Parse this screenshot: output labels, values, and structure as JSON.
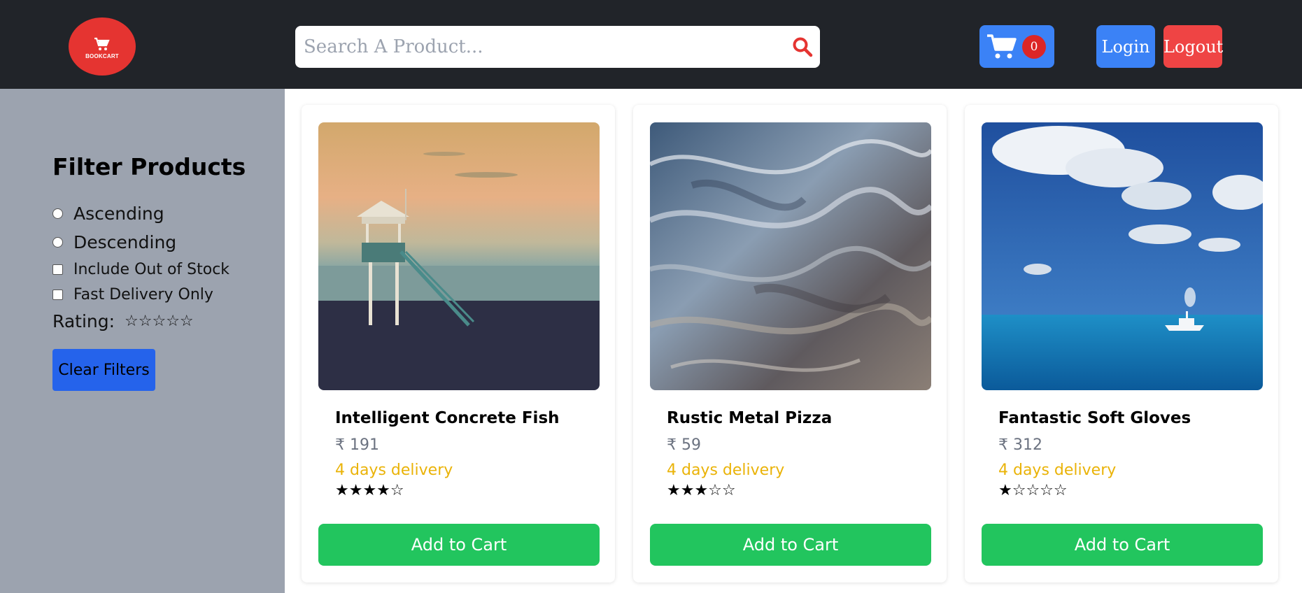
{
  "header": {
    "logo_text": "BOOKCART",
    "search_placeholder": "Search A Product...",
    "cart_count": "0",
    "login_label": "Login",
    "logout_label": "Logout",
    "colors": {
      "bg": "#212429",
      "logo": "#e53431",
      "cart": "#3b82f6",
      "login": "#3b82f6",
      "logout": "#ef4444"
    }
  },
  "sidebar": {
    "title": "Filter Products",
    "sort_options": [
      {
        "label": "Ascending",
        "checked": false
      },
      {
        "label": "Descending",
        "checked": false
      }
    ],
    "checkboxes": [
      {
        "label": "Include Out of Stock",
        "checked": false
      },
      {
        "label": "Fast Delivery Only",
        "checked": false
      }
    ],
    "rating_label": "Rating:",
    "rating_stars": "☆☆☆☆☆",
    "rating_value": 0,
    "clear_label": "Clear Filters"
  },
  "products": [
    {
      "name": "Intelligent Concrete Fish",
      "price": "₹ 191",
      "delivery": "4 days delivery",
      "rating": 4,
      "stars": "★★★★☆",
      "button": "Add to Cart",
      "image": "lifeguard-tower-beach"
    },
    {
      "name": "Rustic Metal Pizza",
      "price": "₹ 59",
      "delivery": "4 days delivery",
      "rating": 3,
      "stars": "★★★☆☆",
      "button": "Add to Cart",
      "image": "abstract-water-texture"
    },
    {
      "name": "Fantastic Soft Gloves",
      "price": "₹ 312",
      "delivery": "4 days delivery",
      "rating": 1,
      "stars": "★☆☆☆☆",
      "button": "Add to Cart",
      "image": "boat-on-sea-clouds"
    }
  ]
}
